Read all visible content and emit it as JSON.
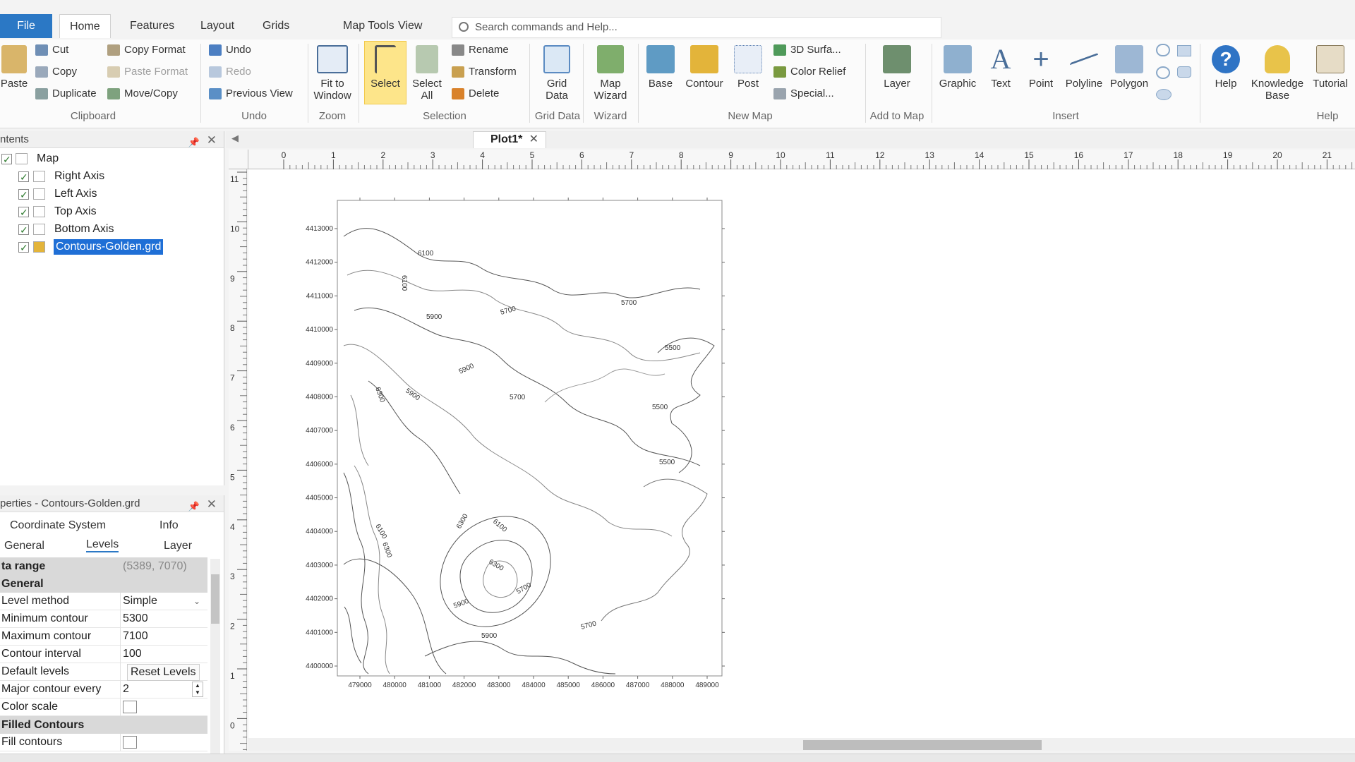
{
  "tabs": {
    "file": "File",
    "items": [
      "Home",
      "Features",
      "Layout",
      "Grids",
      "Map Tools",
      "View"
    ],
    "active": "Home"
  },
  "search": {
    "placeholder": "Search commands and Help..."
  },
  "ribbon": {
    "clipboard": {
      "paste": "Paste",
      "cut": "Cut",
      "copy": "Copy",
      "duplicate": "Duplicate",
      "copy_format": "Copy Format",
      "paste_format": "Paste Format",
      "move_copy": "Move/Copy",
      "group": "Clipboard"
    },
    "undo": {
      "undo": "Undo",
      "redo": "Redo",
      "previous_view": "Previous View",
      "group": "Undo"
    },
    "zoom": {
      "fit_line1": "Fit to",
      "fit_line2": "Window",
      "group": "Zoom"
    },
    "selection": {
      "select": "Select",
      "select_all_line1": "Select",
      "select_all_line2": "All",
      "rename": "Rename",
      "transform": "Transform",
      "delete": "Delete",
      "group": "Selection"
    },
    "grid_data": {
      "line1": "Grid",
      "line2": "Data",
      "group": "Grid Data"
    },
    "wizard": {
      "line1": "Map",
      "line2": "Wizard",
      "group": "Wizard"
    },
    "new_map": {
      "base": "Base",
      "contour": "Contour",
      "post": "Post",
      "surface": "3D Surfa...",
      "color_relief": "Color Relief",
      "special": "Special...",
      "group": "New Map"
    },
    "add_to_map": {
      "layer": "Layer",
      "group": "Add to Map"
    },
    "insert": {
      "graphic": "Graphic",
      "text": "Text",
      "point": "Point",
      "polyline": "Polyline",
      "polygon": "Polygon",
      "group": "Insert"
    },
    "help": {
      "help": "Help",
      "kb_line1": "Knowledge",
      "kb_line2": "Base",
      "tutorial": "Tutorial",
      "group": "Help"
    }
  },
  "contents_panel": {
    "title": "ntents",
    "items": [
      {
        "label": "Map",
        "checked": true
      },
      {
        "label": "Right Axis",
        "checked": true
      },
      {
        "label": "Left Axis",
        "checked": true
      },
      {
        "label": "Top Axis",
        "checked": true
      },
      {
        "label": "Bottom Axis",
        "checked": true
      },
      {
        "label": "Contours-Golden.grd",
        "checked": true,
        "selected": true
      }
    ]
  },
  "properties_panel": {
    "title": "perties - Contours-Golden.grd",
    "tabs_row1": [
      "Coordinate System",
      "Info"
    ],
    "tabs_row2": [
      "General",
      "Levels",
      "Layer"
    ],
    "active_tab": "Levels",
    "data_range_label": "ta range",
    "data_range_value": "(5389, 7070)",
    "general_header": "General",
    "rows": [
      {
        "key": "Level method",
        "value": "Simple"
      },
      {
        "key": "Minimum contour",
        "value": "5300"
      },
      {
        "key": "Maximum contour",
        "value": "7100"
      },
      {
        "key": "Contour interval",
        "value": "100"
      },
      {
        "key": "Default levels",
        "value": "Reset Levels"
      },
      {
        "key": "Major contour every",
        "value": "2"
      },
      {
        "key": "Color scale",
        "value": ""
      }
    ],
    "filled_header": "Filled Contours",
    "fill_contours": "Fill contours"
  },
  "document": {
    "tab": "Plot1*"
  },
  "ruler": {
    "h_labels": [
      "0",
      "1",
      "2",
      "3",
      "4",
      "5",
      "6",
      "7",
      "8",
      "9",
      "10",
      "11",
      "12",
      "13",
      "14",
      "15",
      "16",
      "17",
      "18",
      "19",
      "20",
      "21"
    ],
    "v_labels": [
      "11",
      "10",
      "9",
      "8",
      "7",
      "6",
      "5",
      "4",
      "3",
      "2",
      "1",
      "0"
    ]
  },
  "map": {
    "y_labels": [
      "4413000",
      "4412000",
      "4411000",
      "4410000",
      "4409000",
      "4408000",
      "4407000",
      "4406000",
      "4405000",
      "4404000",
      "4403000",
      "4402000",
      "4401000",
      "4400000"
    ],
    "x_labels": [
      "479000",
      "480000",
      "481000",
      "482000",
      "483000",
      "484000",
      "485000",
      "486000",
      "487000",
      "488000",
      "489000"
    ],
    "contour_labels": [
      "6100",
      "6100",
      "5900",
      "5700",
      "5700",
      "5500",
      "5900",
      "5700",
      "6300",
      "5900",
      "5500",
      "5500",
      "6100",
      "6300",
      "6100",
      "6300",
      "5700",
      "5900",
      "5900",
      "5700",
      "6300"
    ]
  }
}
